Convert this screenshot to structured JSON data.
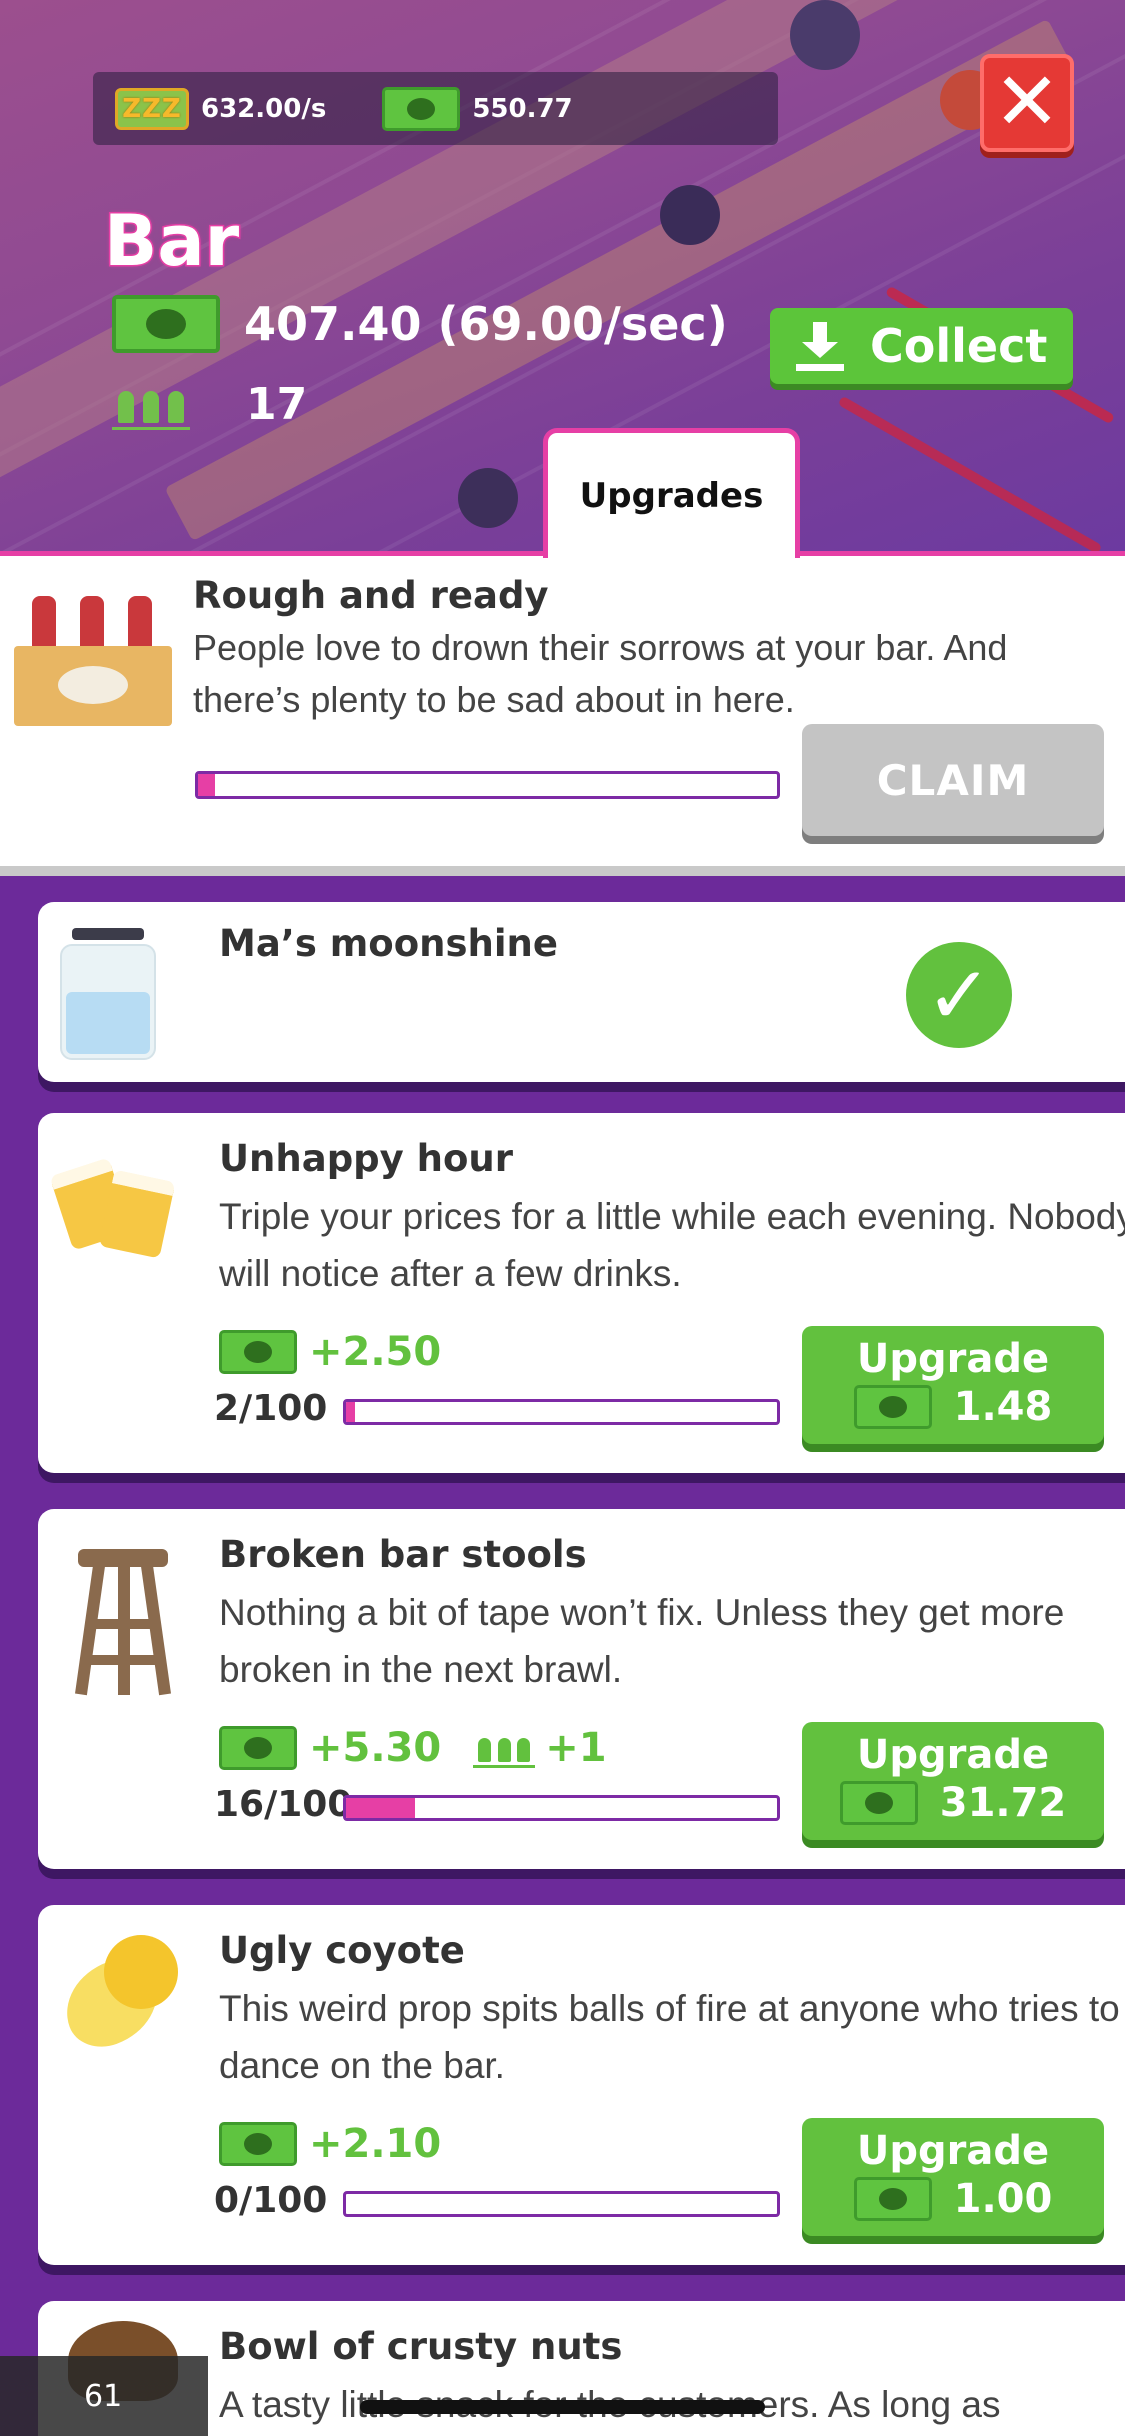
{
  "header": {
    "idle_rate": "632.00/s",
    "cash_total": "550.77",
    "close_label": "✕",
    "venue_title": "Bar",
    "income": "407.40 (69.00/sec)",
    "staff_count": "17",
    "collect_label": "Collect"
  },
  "tabs": {
    "active": "Upgrades"
  },
  "quest": {
    "title": "Rough and ready",
    "description": "People love to drown their sorrows at your bar. And there’s plenty to be sad about in here.",
    "progress": 0.03,
    "claim_label": "CLAIM"
  },
  "upgrades": [
    {
      "title": "Ma’s moonshine",
      "completed": true
    },
    {
      "title": "Unhappy hour",
      "description": "Triple your prices for a little while each evening. Nobody will notice after a few drinks.",
      "bonus": "+2.50",
      "level": "2/100",
      "progress": 0.02,
      "button_label": "Upgrade",
      "cost": "1.48"
    },
    {
      "title": "Broken bar stools",
      "description": "Nothing a bit of tape won’t fix. Unless they get more broken in the next brawl.",
      "bonus": "+5.30",
      "staff_bonus": "+1",
      "level": "16/100",
      "progress": 0.16,
      "button_label": "Upgrade",
      "cost": "31.72"
    },
    {
      "title": "Ugly coyote",
      "description": "This weird prop spits balls of fire at anyone who tries to dance on the bar.",
      "bonus": "+2.10",
      "level": "0/100",
      "progress": 0.0,
      "button_label": "Upgrade",
      "cost": "1.00"
    },
    {
      "title": "Bowl of crusty nuts",
      "description": "A tasty little snack for the customers. As long as"
    }
  ],
  "overlay": {
    "fps": "61"
  },
  "colors": {
    "accent_pink": "#e63fa5",
    "upgrade_green": "#62c13e",
    "background_purple": "#6c2a9a",
    "close_red": "#e53935"
  }
}
